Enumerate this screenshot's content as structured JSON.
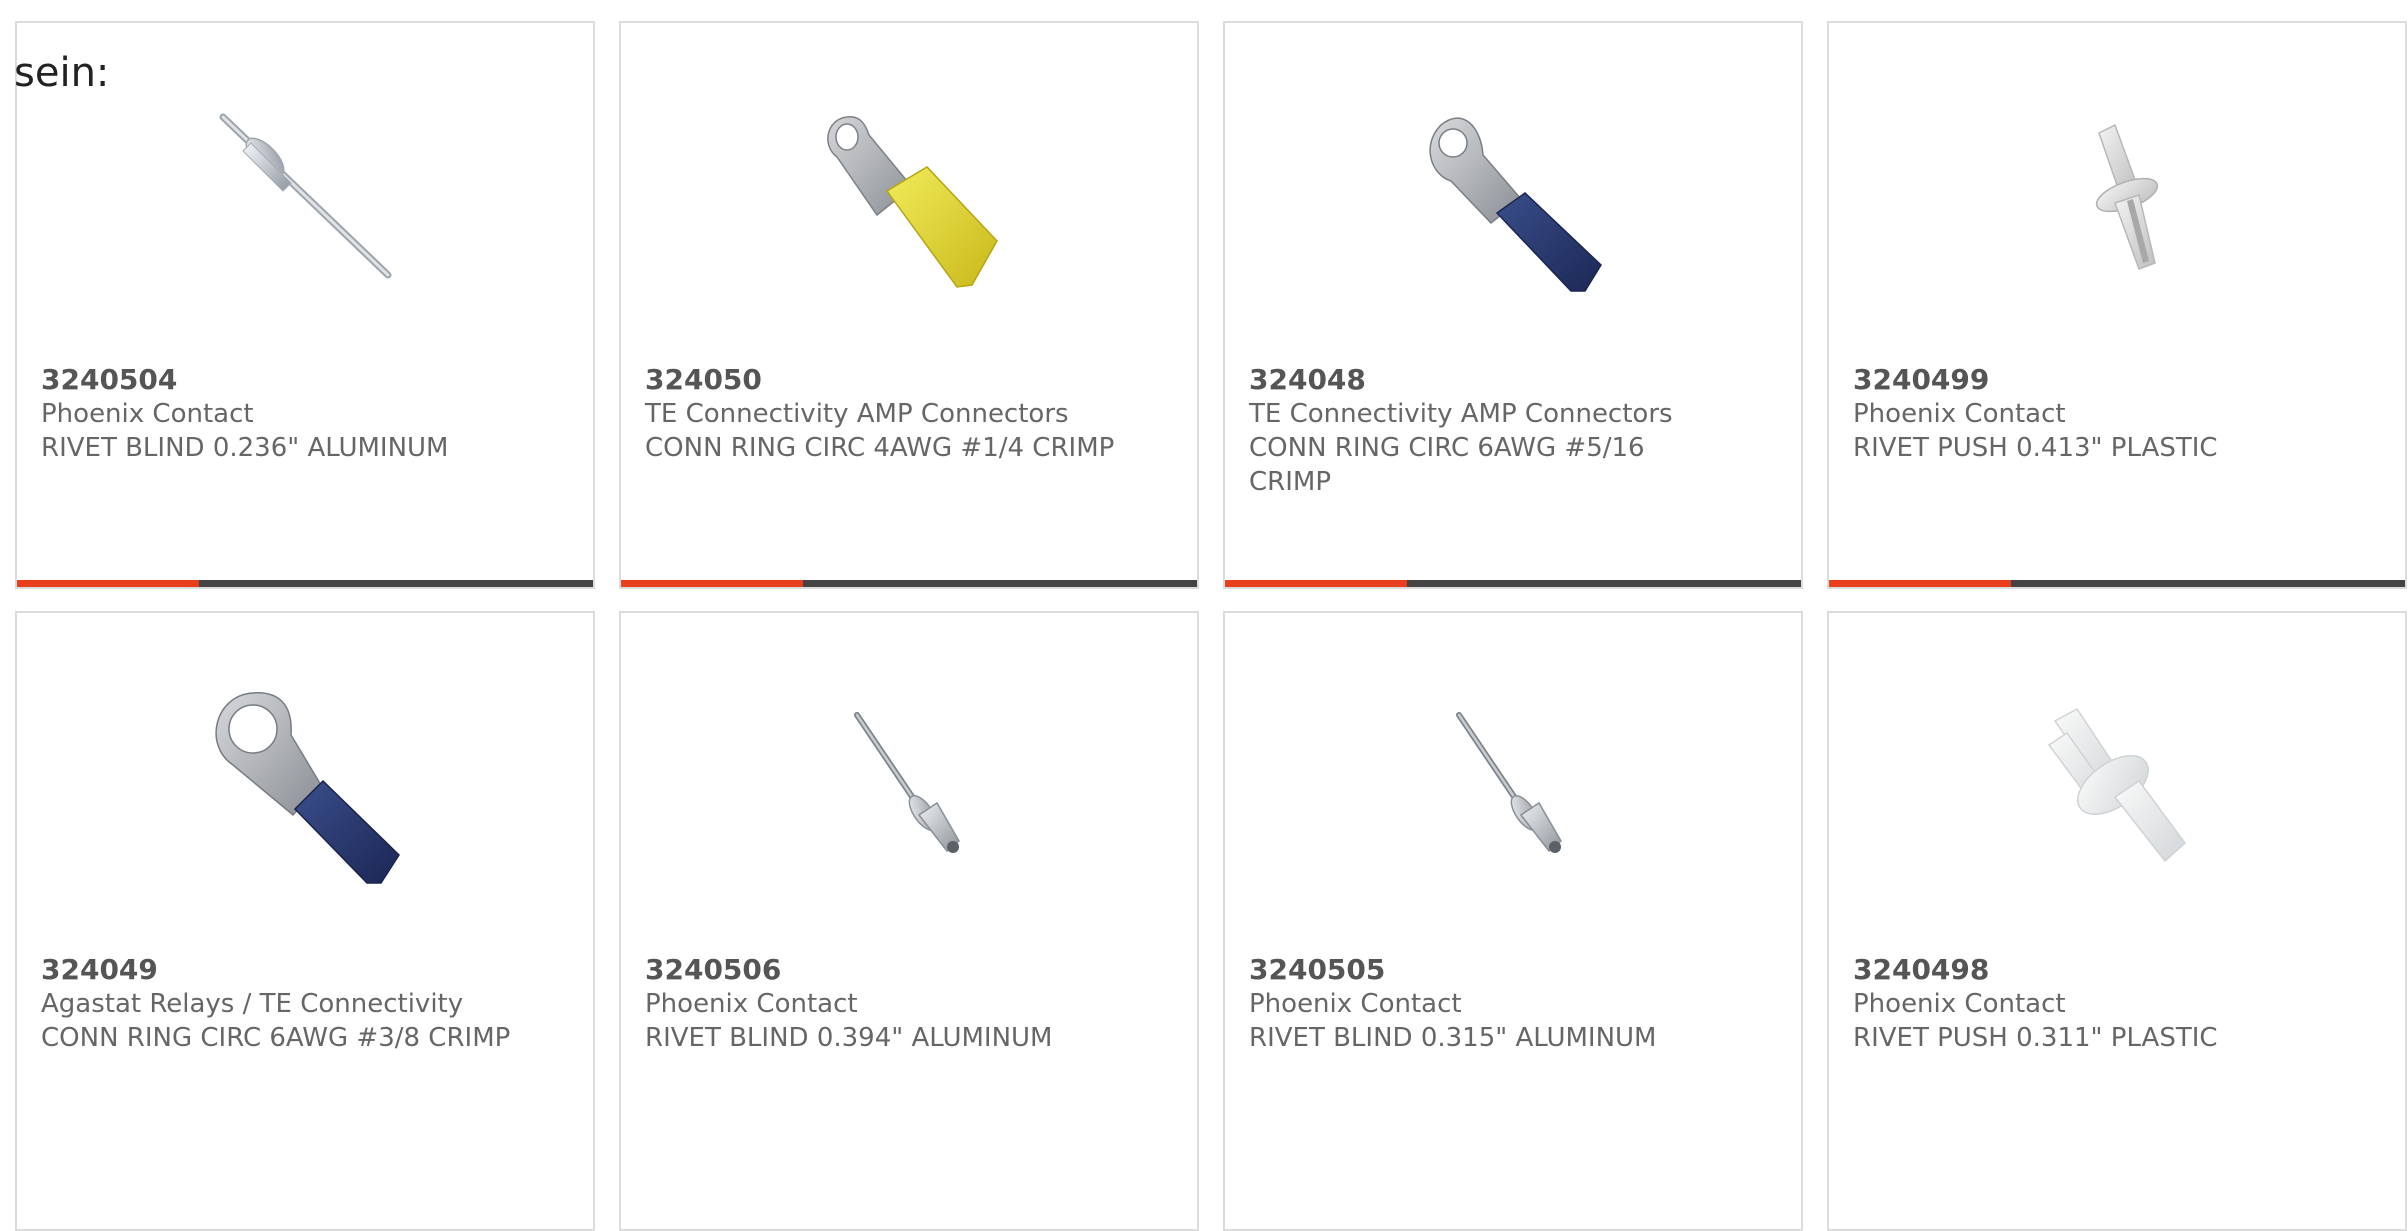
{
  "heading": "sein:",
  "colors": {
    "accent": "#e8401c",
    "bar": "#444444",
    "border": "#dcdcdc",
    "text": "#666666"
  },
  "products": [
    {
      "part_number": "3240504",
      "manufacturer": "Phoenix Contact",
      "description": "RIVET BLIND 0.236\" ALUMINUM",
      "image": "blind-rivet-long-icon"
    },
    {
      "part_number": "324050",
      "manufacturer": "TE Connectivity AMP Connectors",
      "description": "CONN RING CIRC 4AWG #1/4 CRIMP",
      "image": "ring-terminal-yellow-icon"
    },
    {
      "part_number": "324048",
      "manufacturer": "TE Connectivity AMP Connectors",
      "description": "CONN RING CIRC 6AWG #5/16 CRIMP",
      "image": "ring-terminal-blue-icon"
    },
    {
      "part_number": "3240499",
      "manufacturer": "Phoenix Contact",
      "description": "RIVET PUSH 0.413\" PLASTIC",
      "image": "push-rivet-icon"
    },
    {
      "part_number": "324049",
      "manufacturer": "Agastat Relays / TE Connectivity",
      "description": "CONN RING CIRC 6AWG #3/8 CRIMP",
      "image": "ring-terminal-blue-large-icon"
    },
    {
      "part_number": "3240506",
      "manufacturer": "Phoenix Contact",
      "description": "RIVET BLIND 0.394\" ALUMINUM",
      "image": "blind-rivet-icon"
    },
    {
      "part_number": "3240505",
      "manufacturer": "Phoenix Contact",
      "description": "RIVET BLIND 0.315\" ALUMINUM",
      "image": "blind-rivet-icon"
    },
    {
      "part_number": "3240498",
      "manufacturer": "Phoenix Contact",
      "description": "RIVET PUSH 0.311\" PLASTIC",
      "image": "push-rivet-white-icon"
    }
  ]
}
